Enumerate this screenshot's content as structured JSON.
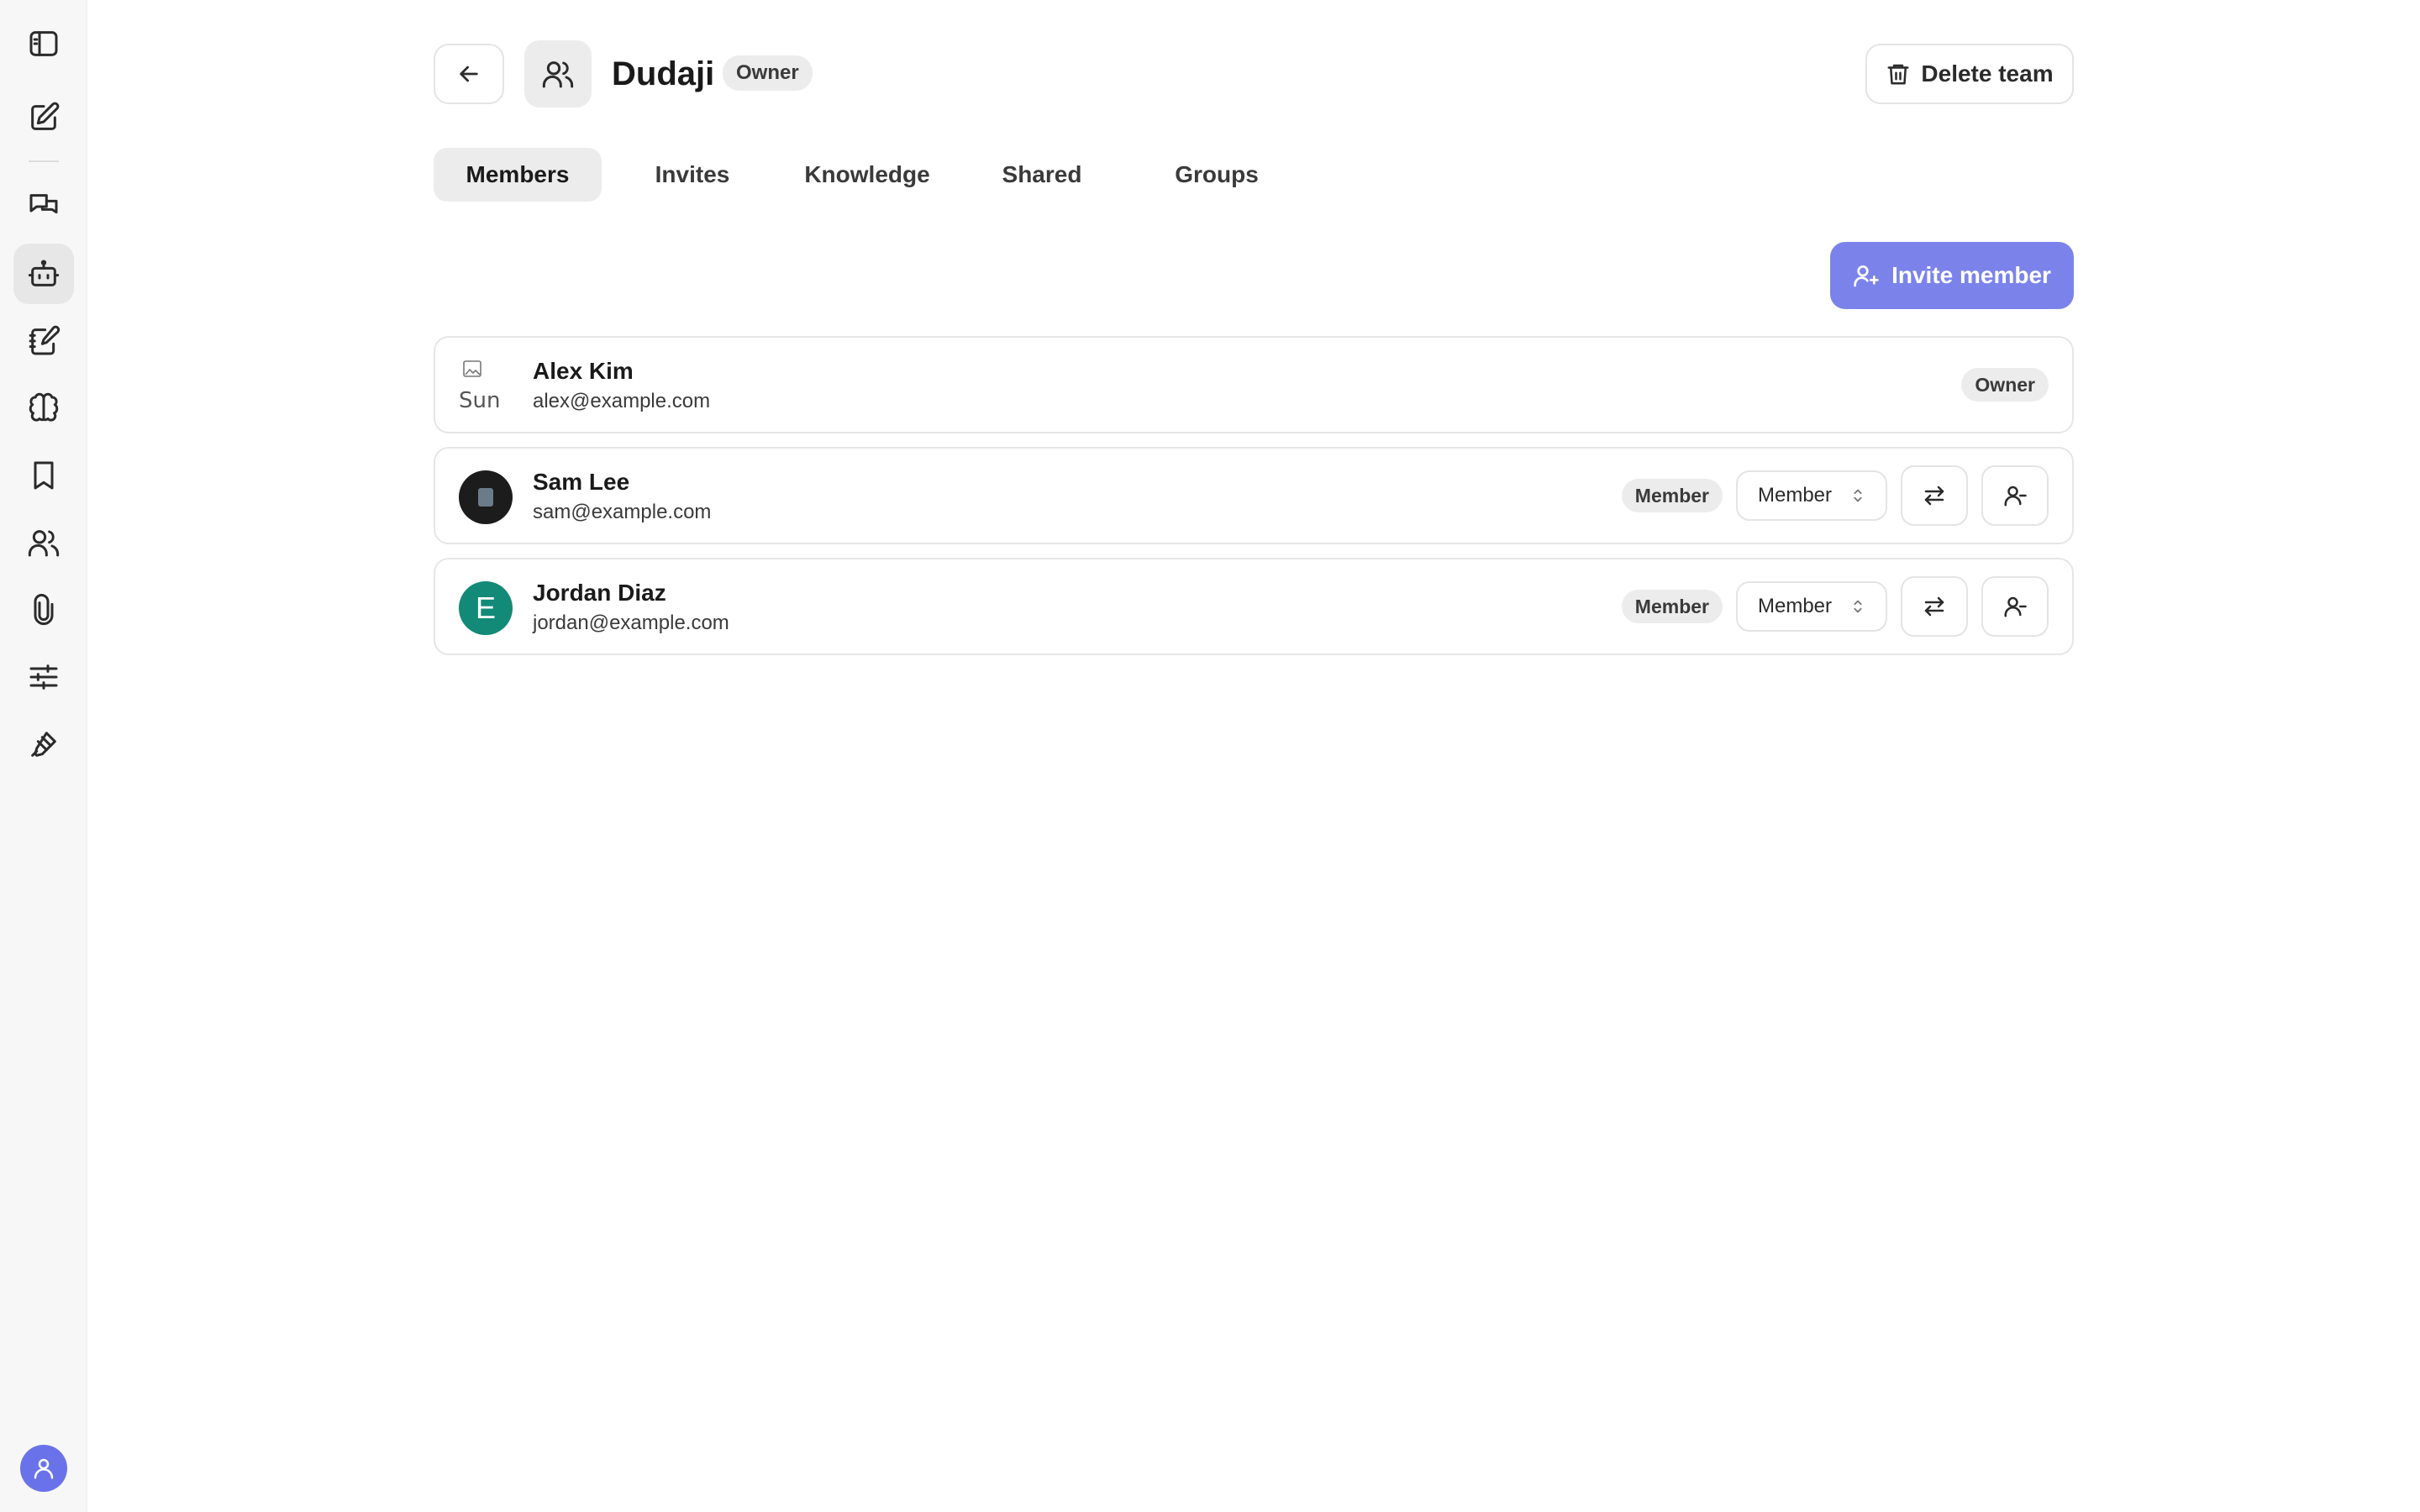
{
  "team": {
    "name": "Dudaji",
    "role_badge": "Owner",
    "delete_label": "Delete team"
  },
  "tabs": [
    {
      "label": "Members",
      "active": true
    },
    {
      "label": "Invites",
      "active": false
    },
    {
      "label": "Knowledge",
      "active": false
    },
    {
      "label": "Shared",
      "active": false
    },
    {
      "label": "Groups",
      "active": false
    }
  ],
  "invite_label": "Invite member",
  "members": [
    {
      "name": "Alex Kim",
      "email": "alex@example.com",
      "role_badge": "Owner",
      "avatar": "broken-image",
      "avatar_alt": "Sun"
    },
    {
      "name": "Sam Lee",
      "email": "sam@example.com",
      "role_badge": "Member",
      "role_select": "Member",
      "avatar": "dark-photo"
    },
    {
      "name": "Jordan Diaz",
      "email": "jordan@example.com",
      "role_badge": "Member",
      "role_select": "Member",
      "avatar": "initial",
      "avatar_initial": "E"
    }
  ],
  "sidebar": {
    "icons": [
      "panel-toggle-icon",
      "new-note-icon",
      "chats-icon",
      "bot-icon",
      "notes-icon",
      "brain-icon",
      "bookmark-icon",
      "users-icon",
      "attachment-icon",
      "settings-sliders-icon",
      "pen-tool-icon"
    ],
    "active": "bot-icon"
  },
  "colors": {
    "accent": "#7b83eb",
    "user_avatar": "#6a72ea",
    "teal_avatar": "#138a78"
  }
}
